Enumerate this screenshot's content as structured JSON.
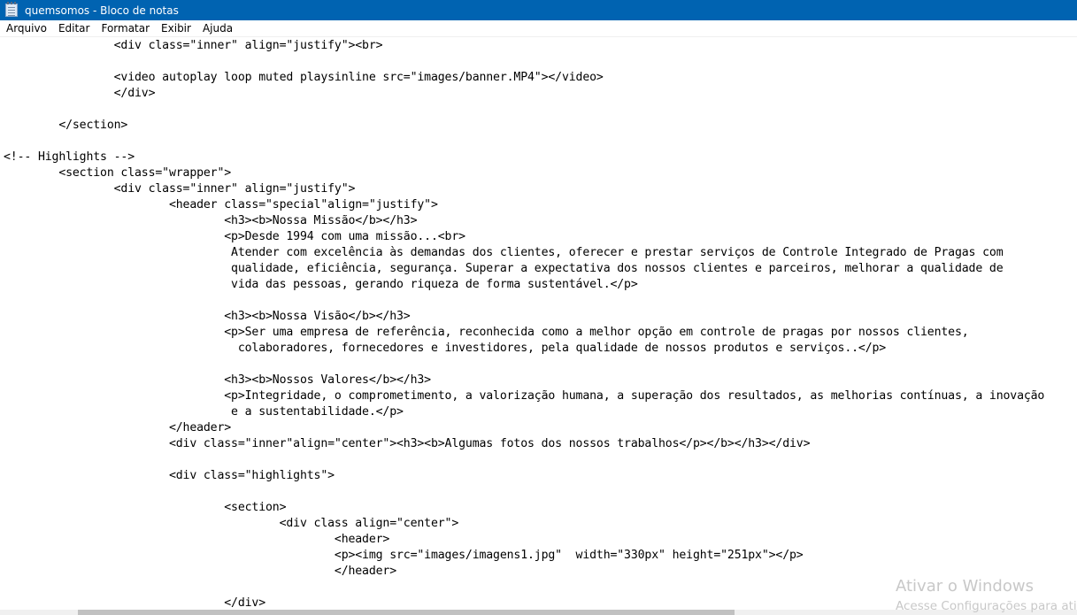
{
  "window": {
    "title": "quemsomos - Bloco de notas",
    "icon": "notepad-icon",
    "titlebar_color": "#0063b1"
  },
  "menu": {
    "items": [
      "Arquivo",
      "Editar",
      "Formatar",
      "Exibir",
      "Ajuda"
    ]
  },
  "editor": {
    "lines": [
      "                <div class=\"inner\" align=\"justify\"><br>",
      "",
      "                <video autoplay loop muted playsinline src=\"images/banner.MP4\"></video>",
      "                </div>",
      "",
      "        </section>",
      "",
      "<!-- Highlights -->",
      "        <section class=\"wrapper\">",
      "                <div class=\"inner\" align=\"justify\">",
      "                        <header class=\"special\"align=\"justify\">",
      "                                <h3><b>Nossa Missão</b></h3>",
      "                                <p>Desde 1994 com uma missão...<br>",
      "                                 Atender com excelência às demandas dos clientes, oferecer e prestar serviços de Controle Integrado de Pragas com",
      "                                 qualidade, eficiência, segurança. Superar a expectativa dos nossos clientes e parceiros, melhorar a qualidade de",
      "                                 vida das pessoas, gerando riqueza de forma sustentável.</p>",
      "",
      "                                <h3><b>Nossa Visão</b></h3>",
      "                                <p>Ser uma empresa de referência, reconhecida como a melhor opção em controle de pragas por nossos clientes,",
      "                                  colaboradores, fornecedores e investidores, pela qualidade de nossos produtos e serviços..</p>",
      "",
      "                                <h3><b>Nossos Valores</b></h3>",
      "                                <p>Integridade, o comprometimento, a valorização humana, a superação dos resultados, as melhorias contínuas, a inovação",
      "                                 e a sustentabilidade.</p>",
      "                        </header>",
      "                        <div class=\"inner\"align=\"center\"><h3><b>Algumas fotos dos nossos trabalhos</p></b></h3></div>",
      "",
      "                        <div class=\"highlights\">",
      "",
      "                                <section>",
      "                                        <div class align=\"center\">",
      "                                                <header>",
      "                                                <p><img src=\"images/imagens1.jpg\"  width=\"330px\" height=\"251px\"></p>",
      "                                                </header>",
      "",
      "                                </div>"
    ]
  },
  "watermark": {
    "title": "Ativar o Windows",
    "subtitle": "Acesse Configurações para ativ"
  }
}
